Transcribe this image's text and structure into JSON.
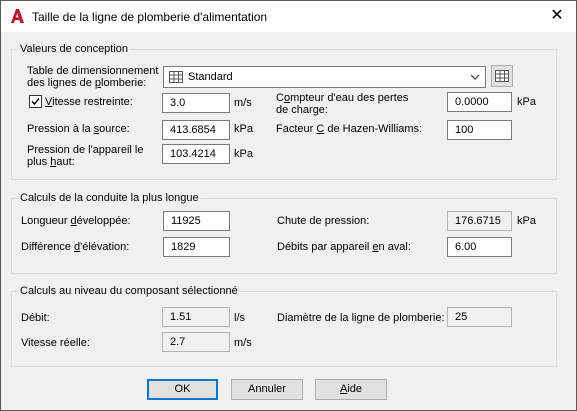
{
  "window": {
    "title": "Taille de la ligne de plomberie d'alimentation",
    "close_glyph": "✕"
  },
  "design": {
    "legend": "Valeurs de conception",
    "table_label_line1": "Table de dimensionnement",
    "table_label_line2_pre": "des lignes de ",
    "table_label_line2_u": "p",
    "table_label_line2_post": "lomberie:",
    "table_value": "Standard",
    "restricted_velocity_checked": true,
    "restricted_velocity_u": "V",
    "restricted_velocity_rest": "itesse restreinte:",
    "restricted_velocity_value": "3.0",
    "restricted_velocity_unit": "m/s",
    "source_pressure_pre": "Pression à la ",
    "source_pressure_u": "s",
    "source_pressure_post": "ource:",
    "source_pressure_value": "413.6854",
    "source_pressure_unit": "kPa",
    "high_fixture_line1": "Pression de l'appareil le",
    "high_fixture_line2_pre": "plus ",
    "high_fixture_line2_u": "h",
    "high_fixture_line2_post": "aut:",
    "high_fixture_value": "103.4214",
    "high_fixture_unit": "kPa",
    "meter_line1_pre": "C",
    "meter_line1_u": "o",
    "meter_line1_post": "mpteur d'eau des pertes",
    "meter_line2": "de charge:",
    "meter_value": "0.0000",
    "meter_unit": "kPa",
    "hazen_pre": "Facteur ",
    "hazen_u": "C",
    "hazen_post": " de Hazen-Williams:",
    "hazen_value": "100"
  },
  "longest_run": {
    "legend": "Calculs de la conduite la plus longue",
    "developed_pre": "Longueur ",
    "developed_u": "d",
    "developed_post": "éveloppée:",
    "developed_value": "11925",
    "elevation_pre": "Différence ",
    "elevation_u": "d",
    "elevation_post": "'élévation:",
    "elevation_value": "1829",
    "pressure_drop_label": "Chute de pression:",
    "pressure_drop_value": "176.6715",
    "pressure_drop_unit": "kPa",
    "fixture_flow_pre": "Débits par appareil ",
    "fixture_flow_u": "e",
    "fixture_flow_post": "n aval:",
    "fixture_flow_value": "6.00"
  },
  "selected": {
    "legend": "Calculs au niveau du composant sélectionné",
    "flow_label": "Débit:",
    "flow_value": "1.51",
    "flow_unit": "l/s",
    "velocity_label": "Vitesse réelle:",
    "velocity_value": "2.7",
    "velocity_unit": "m/s",
    "diameter_label": "Diamètre de la ligne de plomberie:",
    "diameter_value": "25"
  },
  "buttons": {
    "ok": "OK",
    "cancel": "Annuler",
    "help_u": "A",
    "help_rest": "ide"
  }
}
